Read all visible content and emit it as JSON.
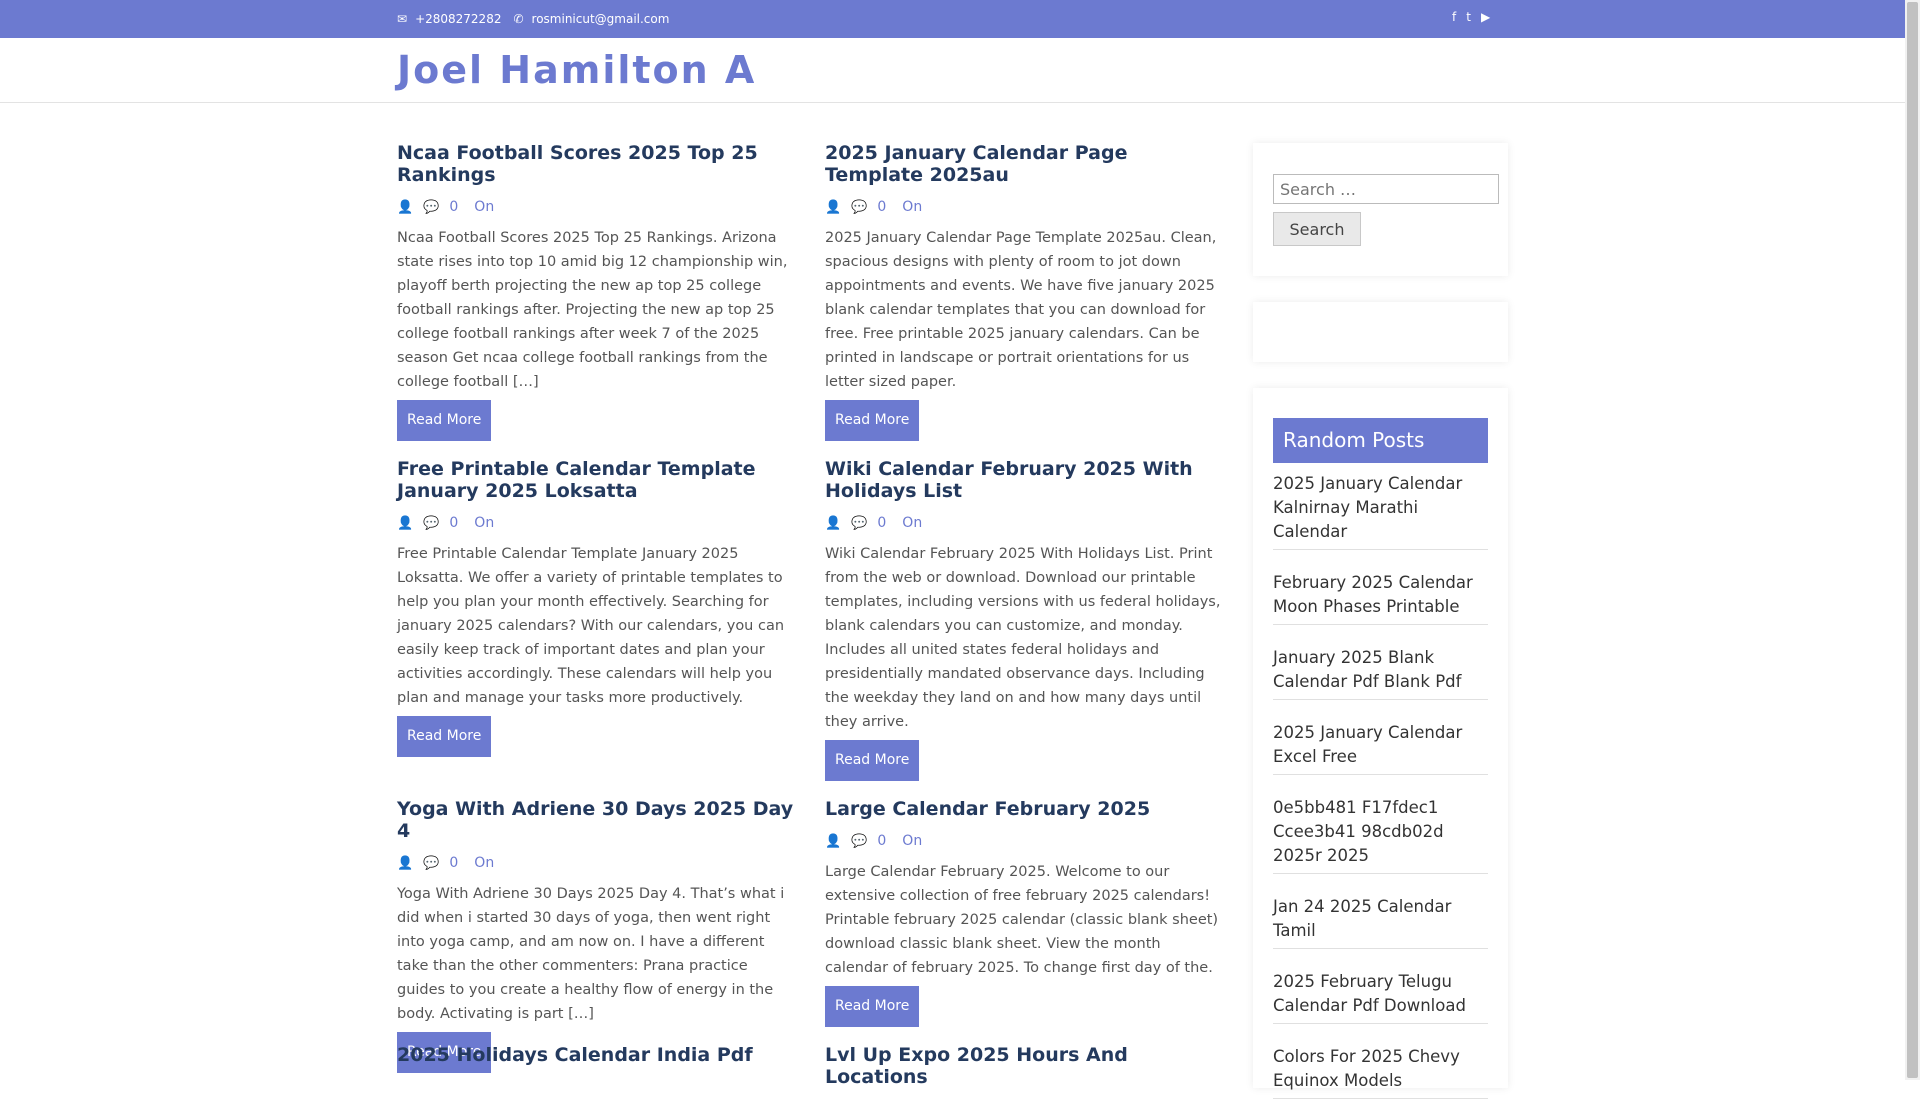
{
  "topbar": {
    "phone": "+2808272282",
    "email": "rosminicut@gmail.com",
    "phone_icon": "envelope-icon",
    "email_icon": "phone-icon",
    "social": [
      "f",
      "t",
      "▶"
    ]
  },
  "site": {
    "title": "Joel Hamilton A"
  },
  "posts": [
    {
      "title": "Ncaa Football Scores 2025 Top 25 Rankings",
      "comments": "0",
      "on": "On",
      "excerpt": "Ncaa Football Scores 2025 Top 25 Rankings. Arizona state rises into top 10 amid big 12 championship win, playoff berth projecting the new ap top 25 college football rankings after. Projecting the new ap top 25 college football rankings after week 7 of the 2025 season Get ncaa college football rankings from the college football […]",
      "read_more": "Read More"
    },
    {
      "title": "2025 January Calendar Page Template 2025au",
      "comments": "0",
      "on": "On",
      "excerpt": "2025 January Calendar Page Template 2025au. Clean, spacious designs with plenty of room to jot down appointments and events. We have five january 2025 blank calendar templates that you can download for free. Free printable 2025 january calendars. Can be printed in landscape or portrait orientations for us letter sized paper.",
      "read_more": "Read More"
    },
    {
      "title": "Free Printable Calendar Template January 2025 Loksatta",
      "comments": "0",
      "on": "On",
      "excerpt": "Free Printable Calendar Template January 2025 Loksatta. We offer a variety of printable templates to help you plan your month effectively. Searching for january 2025 calendars? With our calendars, you can easily keep track of important dates and plan your activities accordingly. These calendars will help you plan and manage your tasks more productively.",
      "read_more": "Read More"
    },
    {
      "title": "Wiki Calendar February 2025 With Holidays List",
      "comments": "0",
      "on": "On",
      "excerpt": "Wiki Calendar February 2025 With Holidays List. Print from the web or download. Download our printable templates, including versions with us federal holidays, blank calendars you can customize, and monday. Includes all united states federal holidays and presidentially mandated observance days. Including the weekday they land on and how many days until they arrive.",
      "read_more": "Read More"
    },
    {
      "title": "Yoga With Adriene 30 Days 2025 Day 4",
      "comments": "0",
      "on": "On",
      "excerpt": "Yoga With Adriene 30 Days 2025 Day 4. That’s what i did when i started 30 days of yoga, then went right into yoga camp, and am now on. I have a different take than the other commenters: Prana practice guides to you create a healthy flow of energy in the body. Activating is part […]",
      "read_more": "Read More"
    },
    {
      "title": "Large Calendar February 2025",
      "comments": "0",
      "on": "On",
      "excerpt": "Large Calendar February 2025. Welcome to our extensive collection of free february 2025 calendars! Printable february 2025 calendar (classic blank sheet) download classic blank sheet. View the month calendar of february 2025. To change first day of the.",
      "read_more": "Read More"
    },
    {
      "title": "2025 Holidays Calendar India Pdf"
    },
    {
      "title": "Lvl Up Expo 2025 Hours And Locations"
    }
  ],
  "sidebar": {
    "search_placeholder": "Search …",
    "search_button": "Search",
    "random_posts_title": "Random Posts",
    "random_posts": [
      "2025 January Calendar Kalnirnay Marathi Calendar",
      "February 2025 Calendar Moon Phases Printable",
      "January 2025 Blank Calendar Pdf Blank Pdf",
      "2025 January Calendar Excel Free",
      "0e5bb481 F17fdec1 Ccee3b41 98cdb02d 2025r 2025",
      "Jan 24 2025 Calendar Tamil",
      "2025 February Telugu Calendar Pdf Download",
      "Colors For 2025 Chevy Equinox Models"
    ]
  },
  "colors": {
    "accent": "#6c7ad0",
    "title": "#243a5e"
  }
}
